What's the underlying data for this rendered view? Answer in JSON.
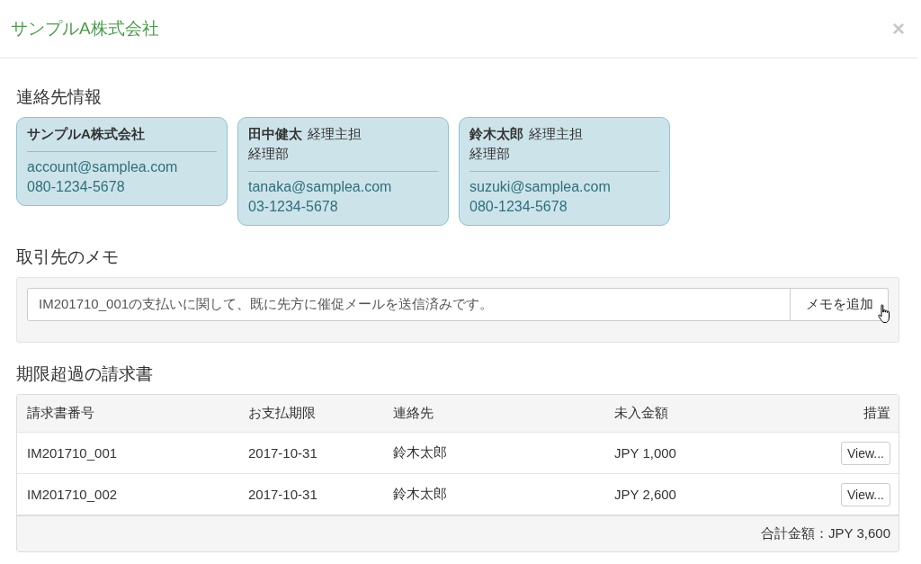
{
  "dialog": {
    "title": "サンプルA株式会社",
    "close": "×"
  },
  "contacts": {
    "heading": "連絡先情報",
    "cards": [
      {
        "name": "サンプルA株式会社",
        "email": "account@samplea.com",
        "phone": "080-1234-5678"
      },
      {
        "name": "田中健太",
        "role": "経理主担",
        "department": "経理部",
        "email": "tanaka@samplea.com",
        "phone": "03-1234-5678"
      },
      {
        "name": "鈴木太郎",
        "role": "経理主担",
        "department": "経理部",
        "email": "suzuki@samplea.com",
        "phone": "080-1234-5678"
      }
    ]
  },
  "memo": {
    "heading": "取引先のメモ",
    "value": "IM201710_001の支払いに関して、既に先方に催促メールを送信済みです。",
    "button": "メモを追加"
  },
  "invoices": {
    "heading": "期限超過の請求書",
    "columns": [
      "請求書番号",
      "お支払期限",
      "連絡先",
      "未入金額",
      "措置"
    ],
    "rows": [
      {
        "number": "IM201710_001",
        "due": "2017-10-31",
        "contact": "鈴木太郎",
        "amount": "JPY 1,000",
        "action": "View..."
      },
      {
        "number": "IM201710_002",
        "due": "2017-10-31",
        "contact": "鈴木太郎",
        "amount": "JPY 2,600",
        "action": "View..."
      }
    ],
    "total": "合計金額：JPY 3,600"
  }
}
